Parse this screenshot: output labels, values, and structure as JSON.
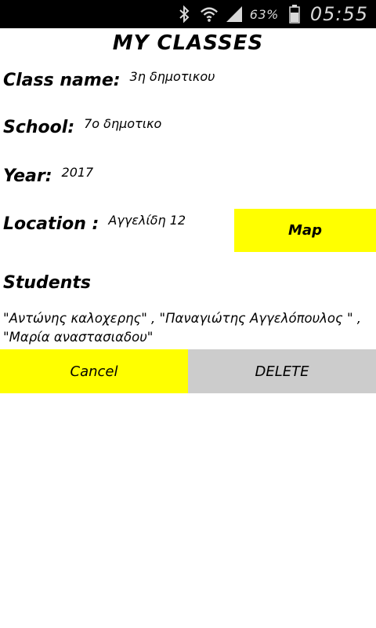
{
  "status_bar": {
    "icons": [
      "bluetooth-icon",
      "wifi-icon",
      "cell-signal-icon",
      "battery-icon"
    ],
    "battery_percent": "63%",
    "time": "05:55"
  },
  "title": "MY CLASSES",
  "fields": {
    "class_name": {
      "label": "Class name:",
      "value": "3η δημοτικου"
    },
    "school": {
      "label": "School:",
      "value": "7ο δημοτικο"
    },
    "year": {
      "label": "Year:",
      "value": "2017"
    },
    "location": {
      "label": "Location :",
      "value": "Αγγελίδη 12"
    }
  },
  "map_button_label": "Map",
  "students": {
    "heading": "Students",
    "list_text": " \"Αντώνης καλοχερης\" , \"Παναγιώτης Αγγελόπουλος \" , \"Μαρία αναστασιαδου\""
  },
  "actions": {
    "cancel_label": "Cancel",
    "delete_label": "DELETE"
  },
  "colors": {
    "accent": "#ffff00",
    "secondary_button": "#cccccc",
    "status_bar": "#000000"
  }
}
